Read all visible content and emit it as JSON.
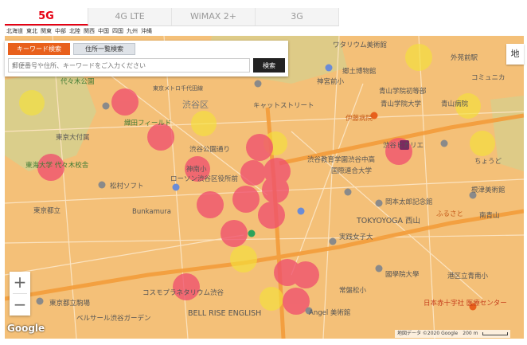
{
  "tabs": [
    {
      "label": "5G",
      "active": true
    },
    {
      "label": "4G LTE",
      "active": false
    },
    {
      "label": "WiMAX 2+",
      "active": false
    },
    {
      "label": "3G",
      "active": false
    }
  ],
  "regions": [
    "北海道",
    "東北",
    "関東",
    "中部",
    "北陸",
    "関西",
    "中国",
    "四国",
    "九州",
    "沖縄"
  ],
  "search": {
    "keyword_tab": "キーワード検索",
    "address_tab": "住所一覧検索",
    "placeholder": "郵便番号や住所、キーワードをご入力ください",
    "button": "検索"
  },
  "map_type_label": "地",
  "zoom": {
    "in": "+",
    "out": "−"
  },
  "google_logo": "Google",
  "attribution": {
    "data": "地図データ ©2020 Google",
    "scale": "200 m"
  },
  "colors": {
    "coverage": "#f4c078",
    "dense": "#f0506e",
    "yellow": "#f5e13a",
    "road": "#f39c3a",
    "park": "#b9d99a"
  },
  "places": [
    {
      "label": "ワタリウム美術館"
    },
    {
      "label": "代々木公園"
    },
    {
      "label": "神宮前小"
    },
    {
      "label": "東京メトロ千代田線"
    },
    {
      "label": "渋谷区"
    },
    {
      "label": "キャットストリート"
    },
    {
      "label": "青山学院大学"
    },
    {
      "label": "青山学院初等部"
    },
    {
      "label": "伊藤病院"
    },
    {
      "label": "織田フィールド"
    },
    {
      "label": "渋谷公園通り"
    },
    {
      "label": "東海大学 代々木校舎"
    },
    {
      "label": "東京大付属"
    },
    {
      "label": "神南小"
    },
    {
      "label": "ローソン渋谷区役所前"
    },
    {
      "label": "松村ソフト"
    },
    {
      "label": "東京都立"
    },
    {
      "label": "Bunkamura"
    },
    {
      "label": "渋谷教育学園渋谷中高"
    },
    {
      "label": "国際連合大学"
    },
    {
      "label": "青山病院"
    },
    {
      "label": "岡本太郎記念館"
    },
    {
      "label": "TOKYOYOGA 西山"
    },
    {
      "label": "渋谷ヒカリエ"
    },
    {
      "label": "実践女子大"
    },
    {
      "label": "國學院大學"
    },
    {
      "label": "常盤松小"
    },
    {
      "label": "コスモプラネタリウム渋谷"
    },
    {
      "label": "東京都立駒場"
    },
    {
      "label": "ベルサール渋谷ガーデン"
    },
    {
      "label": "BELL RISE ENGLISH"
    },
    {
      "label": "日本赤十字社 医療センター"
    },
    {
      "label": "港区立青南小"
    },
    {
      "label": "南青山"
    },
    {
      "label": "コミュニカ"
    },
    {
      "label": "郷土博物館"
    },
    {
      "label": "外苑前駅"
    },
    {
      "label": "ちょうど"
    },
    {
      "label": "ふるさと"
    },
    {
      "label": "根津美術館"
    },
    {
      "label": "Angel 美術館"
    }
  ]
}
